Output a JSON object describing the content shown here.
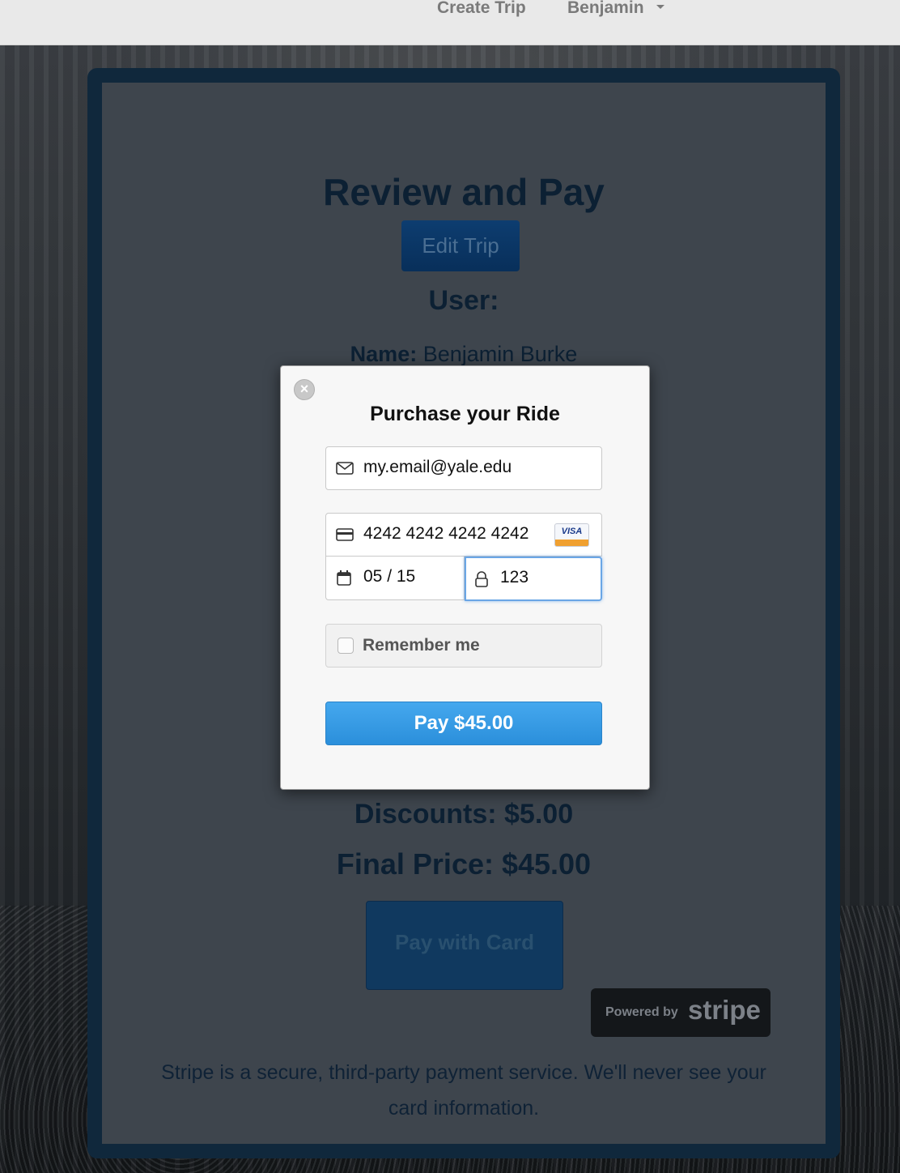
{
  "navbar": {
    "create_trip": "Create Trip",
    "user_menu": "Benjamin"
  },
  "page": {
    "title": "Review and Pay",
    "edit_trip": "Edit Trip",
    "user_heading": "User:",
    "name_label": "Name:",
    "name_value": "Benjamin Burke",
    "discounts": "Discounts: $5.00",
    "final_price": "Final Price: $45.00",
    "pay_with_card": "Pay with Card",
    "powered_by": "Powered by",
    "stripe_logo": "stripe",
    "footer_note": "Stripe is a secure, third-party payment service. We'll never see your card information."
  },
  "modal": {
    "title": "Purchase your Ride",
    "email": "my.email@yale.edu",
    "card_number": "4242 4242 4242 4242",
    "card_brand": "VISA",
    "expiry": "05 / 15",
    "cvc": "123",
    "remember_me": "Remember me",
    "remember_checked": false,
    "pay_button": "Pay $45.00"
  },
  "colors": {
    "accent_pay": "#2b8fdb",
    "panel_dark": "#10283c"
  }
}
